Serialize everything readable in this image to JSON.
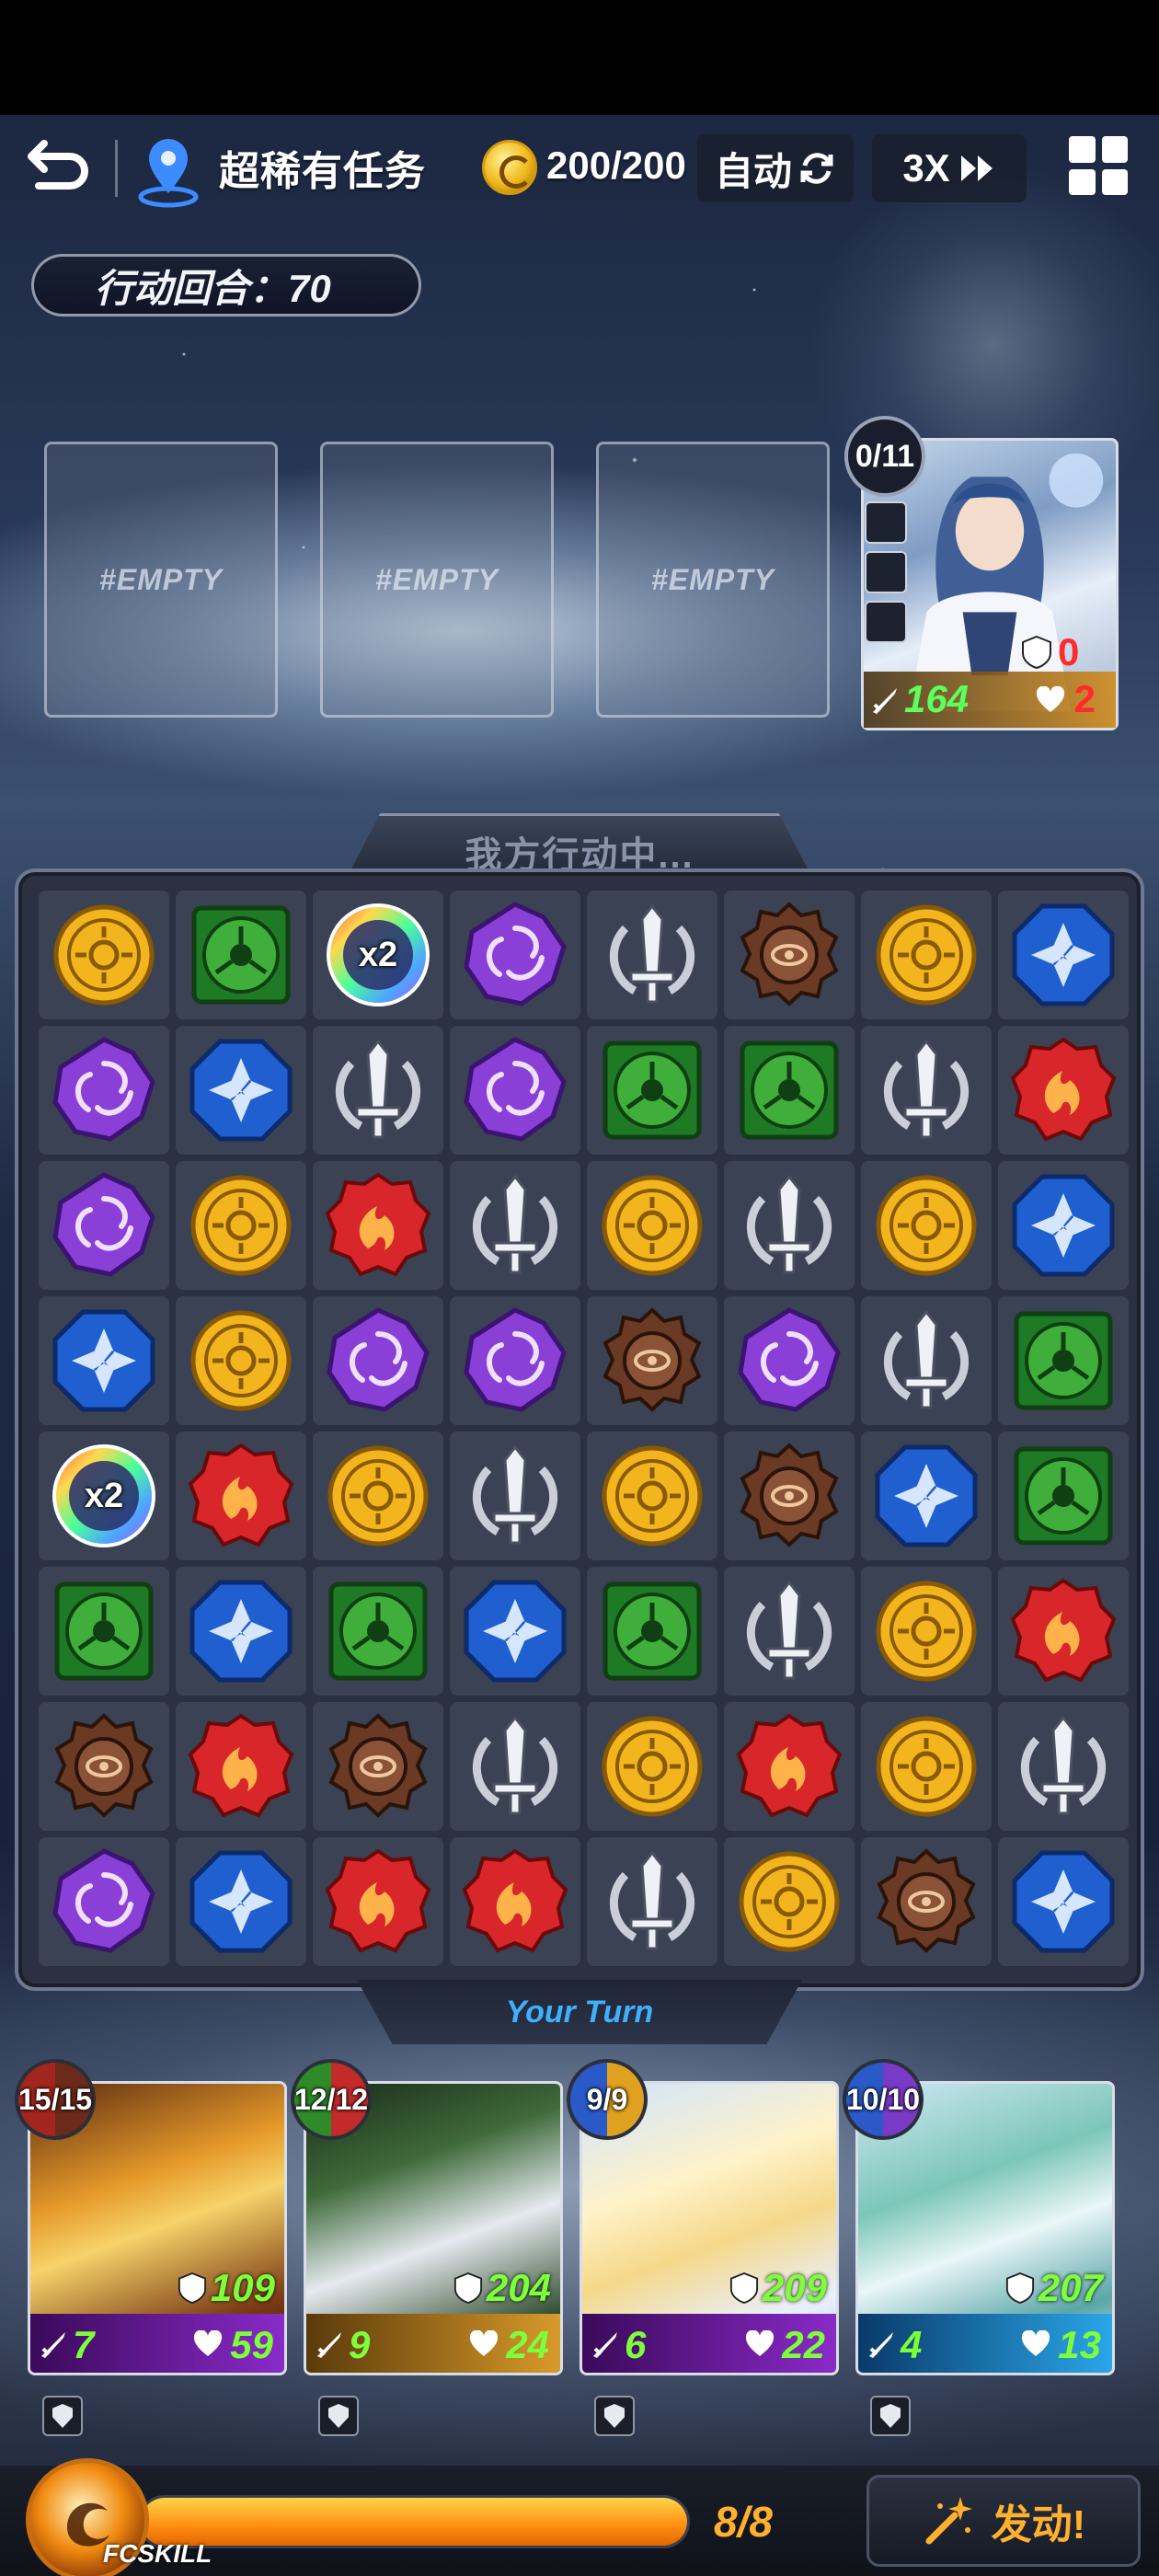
{
  "topbar": {
    "back_icon": "back-arrow-icon",
    "location_icon": "map-pin-icon",
    "mission_title": "超稀有任务",
    "stamina_icon": "coin-icon",
    "stamina": "200/200",
    "auto_label": "自动",
    "speed_label": "3X",
    "menu_icon": "grid-menu-icon"
  },
  "turn_counter": "行动回合：70",
  "enemy_slots": [
    "#EMPTY",
    "#EMPTY",
    "#EMPTY"
  ],
  "enemy": {
    "charge": "0/11",
    "shield": "0",
    "attack": "164",
    "hp": "2"
  },
  "board": {
    "header": "我方行动中...",
    "footer": "Your Turn",
    "rows": [
      [
        "yellow",
        "green",
        "rainbow",
        "purple",
        "silver",
        "brown",
        "yellow",
        "blue"
      ],
      [
        "purple",
        "blue",
        "silver",
        "purple",
        "green",
        "green",
        "silver",
        "red"
      ],
      [
        "purple",
        "yellow",
        "red",
        "silver",
        "yellow",
        "silver",
        "yellow",
        "blue"
      ],
      [
        "blue",
        "yellow",
        "purple",
        "purple",
        "brown",
        "purple",
        "silver",
        "green"
      ],
      [
        "rainbow",
        "red",
        "yellow",
        "silver",
        "yellow",
        "brown",
        "blue",
        "green"
      ],
      [
        "green",
        "blue",
        "green",
        "blue",
        "green",
        "silver",
        "yellow",
        "red"
      ],
      [
        "brown",
        "red",
        "brown",
        "silver",
        "yellow",
        "red",
        "yellow",
        "silver"
      ],
      [
        "purple",
        "blue",
        "red",
        "red",
        "silver",
        "yellow",
        "brown",
        "blue"
      ]
    ],
    "rainbow_label": "x2"
  },
  "heroes": [
    {
      "charge": "15/15",
      "shield": "109",
      "attack": "7",
      "hp": "59"
    },
    {
      "charge": "12/12",
      "shield": "204",
      "attack": "9",
      "hp": "24"
    },
    {
      "charge": "9/9",
      "shield": "209",
      "attack": "6",
      "hp": "22"
    },
    {
      "charge": "10/10",
      "shield": "207",
      "attack": "4",
      "hp": "13"
    }
  ],
  "fc_skill": {
    "label": "FCSKILL",
    "count": "8/8",
    "fill": 1.0,
    "activate_label": "发动!"
  },
  "colors": {
    "yellow": "#f2b51e",
    "green": "#3fae3a",
    "purple": "#8a3fd6",
    "blue": "#1f5fd0",
    "red": "#d8262a",
    "brown": "#6b3a25",
    "silver": "#c9ced8",
    "accent_orange": "#ffb02e",
    "turn_blue": "#3fb0ff"
  }
}
